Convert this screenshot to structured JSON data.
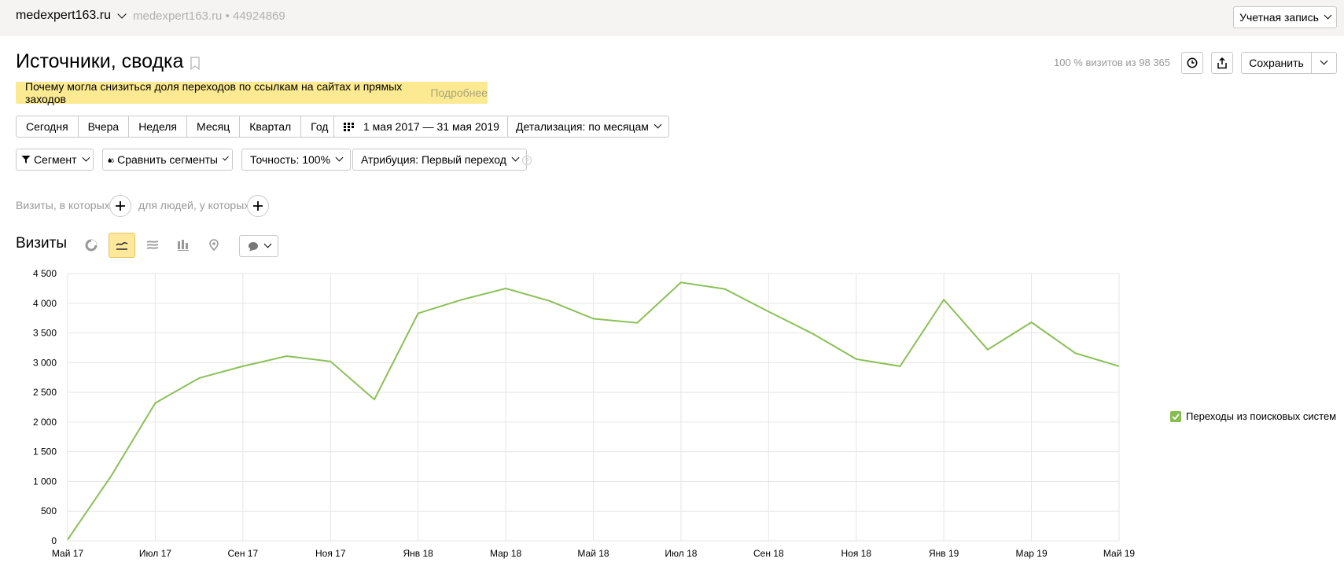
{
  "header": {
    "site": "medexpert163.ru",
    "counter_info": "medexpert163.ru • 44924869",
    "account": "Учетная запись"
  },
  "page": {
    "title": "Источники, сводка",
    "visits_share": "100 % визитов из 98 365",
    "save_label": "Сохранить"
  },
  "notice": {
    "text": "Почему могла снизиться доля переходов по ссылкам на сайтах и прямых заходов",
    "more": "Подробнее"
  },
  "periods": [
    "Сегодня",
    "Вчера",
    "Неделя",
    "Месяц",
    "Квартал",
    "Год"
  ],
  "date_range": "1 мая 2017 — 31 мая 2019",
  "detail": "Детализация: по месяцам",
  "segment": "Сегмент",
  "compare": "Сравнить сегменты",
  "accuracy": "Точность: 100%",
  "attribution": "Атрибуция: Первый переход",
  "filters": {
    "visits_label": "Визиты, в которых",
    "people_label": "для людей, у которых"
  },
  "chart_title": "Визиты",
  "colors": {
    "line": "#8bc057",
    "highlight": "#fde89b",
    "notice": "#fcea92"
  },
  "chart_data": {
    "type": "line",
    "x": [
      "Май 17",
      "Июн 17",
      "Июл 17",
      "Авг 17",
      "Сен 17",
      "Окт 17",
      "Ноя 17",
      "Дек 17",
      "Янв 18",
      "Фев 18",
      "Мар 18",
      "Апр 18",
      "Май 18",
      "Июн 18",
      "Июл 18",
      "Авг 18",
      "Сен 18",
      "Окт 18",
      "Ноя 18",
      "Дек 18",
      "Янв 19",
      "Фев 19",
      "Мар 19",
      "Апр 19",
      "Май 19"
    ],
    "tick_labels": [
      "Май 17",
      "Июл 17",
      "Сен 17",
      "Ноя 17",
      "Янв 18",
      "Мар 18",
      "Май 18",
      "Июл 18",
      "Сен 18",
      "Ноя 18",
      "Янв 19",
      "Мар 19",
      "Май 19"
    ],
    "series": [
      {
        "name": "Переходы из поисковых систем",
        "values": [
          20,
          1100,
          2320,
          2740,
          2940,
          3110,
          3020,
          2380,
          3830,
          4060,
          4250,
          4040,
          3740,
          3670,
          4350,
          4240,
          3860,
          3490,
          3060,
          2940,
          4060,
          3220,
          3680,
          3160,
          2940
        ]
      }
    ],
    "y_ticks": [
      "4 500",
      "4 000",
      "3 500",
      "3 000",
      "2 500",
      "2 000",
      "1 500",
      "1 000",
      "500",
      "0"
    ],
    "ylim": [
      0,
      4500
    ],
    "grid": true,
    "legend_position": "right"
  }
}
